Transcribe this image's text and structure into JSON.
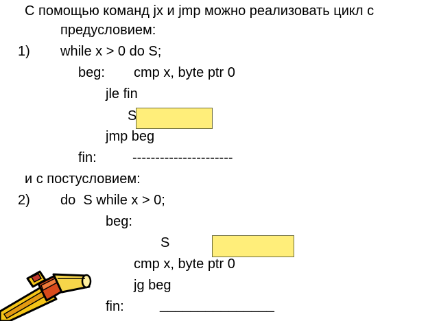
{
  "slide": {
    "intro_line1": "С помощью команд jx и jmp можно реализовать цикл с",
    "intro_line2": "предусловием:",
    "item1": {
      "number": "1)",
      "statement": "while x > 0 do S;",
      "beg_label": "beg:",
      "beg_instr": "cmp x, byte ptr 0",
      "jle": "jle fin",
      "s": "S",
      "jmp": "jmp beg",
      "fin_label": "fin:",
      "fin_line": "----------------------"
    },
    "post_intro": "и с постусловием:",
    "item2": {
      "number": "2)",
      "statement": "do  S while x > 0;",
      "beg_label": "beg:",
      "s": "S",
      "cmp": "cmp x, byte ptr 0",
      "jg": "jg beg",
      "fin_label": "fin:",
      "fin_line": "_______________"
    }
  },
  "colors": {
    "highlight": "#ffee7a",
    "highlight_border": "#6b6b3a",
    "text": "#000000",
    "background": "#ffffff"
  },
  "icons": {
    "pencil": "pencil-clipart-icon"
  }
}
